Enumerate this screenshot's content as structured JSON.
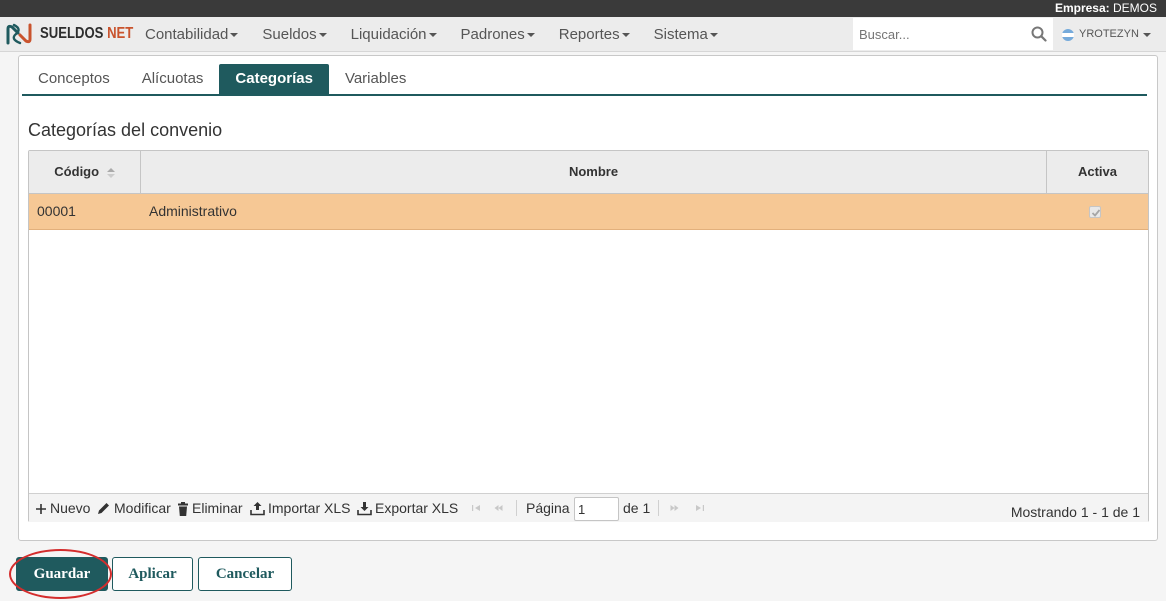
{
  "company": {
    "label": "Empresa:",
    "value": "DEMOS"
  },
  "brand": {
    "part1": "SUELDOS ",
    "part2": "NET",
    "accent_color": "#c9532d"
  },
  "nav": {
    "items": [
      {
        "label": "Contabilidad"
      },
      {
        "label": "Sueldos"
      },
      {
        "label": "Liquidación"
      },
      {
        "label": "Padrones"
      },
      {
        "label": "Reportes"
      },
      {
        "label": "Sistema"
      }
    ]
  },
  "search": {
    "placeholder": "Buscar...",
    "icon": "search-icon"
  },
  "user": {
    "name": "YROTEZYN",
    "icon": "argentina-flag-icon"
  },
  "tabs": [
    {
      "label": "Conceptos",
      "active": false
    },
    {
      "label": "Alícuotas",
      "active": false
    },
    {
      "label": "Categorías",
      "active": true
    },
    {
      "label": "Variables",
      "active": false
    }
  ],
  "section": {
    "title": "Categorías del convenio"
  },
  "grid": {
    "columns": {
      "code": "Código",
      "name": "Nombre",
      "active": "Activa"
    },
    "rows": [
      {
        "code": "00001",
        "name": "Administrativo",
        "active": true
      }
    ],
    "selected_row_color": "#f6c895"
  },
  "toolbar": {
    "new": "Nuevo",
    "edit": "Modificar",
    "delete": "Eliminar",
    "import": "Importar XLS",
    "export": "Exportar XLS"
  },
  "pager": {
    "page_label": "Página",
    "page_value": "1",
    "of_label": "de 1",
    "showing": "Mostrando 1 - 1 de 1"
  },
  "actions": {
    "save": "Guardar",
    "apply": "Aplicar",
    "cancel": "Cancelar"
  },
  "theme": {
    "primary": "#1f5a5e",
    "highlight": "#d42d2d"
  }
}
